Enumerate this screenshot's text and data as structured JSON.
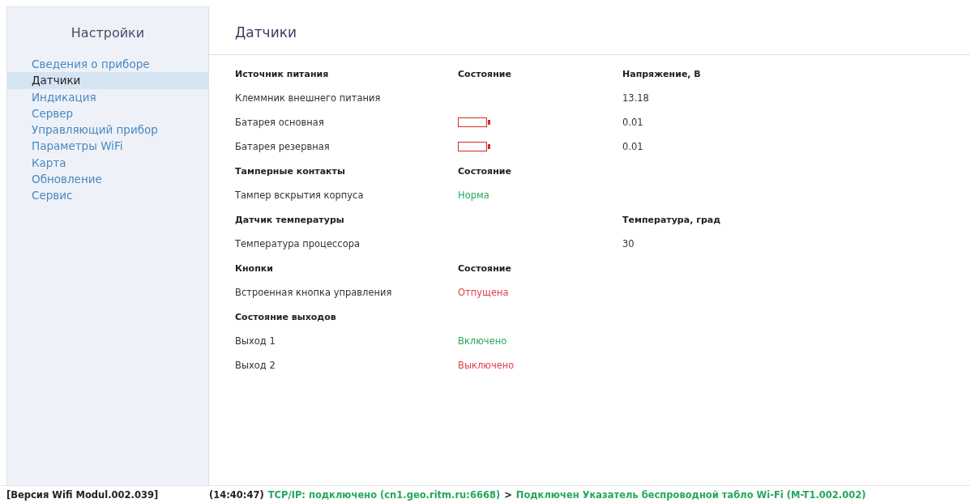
{
  "sidebar": {
    "title": "Настройки",
    "items": [
      {
        "label": "Сведения о приборе",
        "selected": false
      },
      {
        "label": "Датчики",
        "selected": true
      },
      {
        "label": "Индикация",
        "selected": false
      },
      {
        "label": "Сервер",
        "selected": false
      },
      {
        "label": "Управляющий прибор",
        "selected": false
      },
      {
        "label": "Параметры WiFi",
        "selected": false
      },
      {
        "label": "Карта",
        "selected": false
      },
      {
        "label": "Обновление",
        "selected": false
      },
      {
        "label": "Сервис",
        "selected": false
      }
    ]
  },
  "page": {
    "title": "Датчики"
  },
  "sections": [
    {
      "headers": {
        "name": "Источник питания",
        "status": "Состояние",
        "value": "Напряжение, В"
      },
      "rows": [
        {
          "name": "Клеммник внешнего питания",
          "value": "13.18"
        },
        {
          "name": "Батарея основная",
          "battery": {
            "level": 0
          },
          "value": "0.01"
        },
        {
          "name": "Батарея резервная",
          "battery": {
            "level": 0
          },
          "value": "0.01"
        }
      ]
    },
    {
      "headers": {
        "name": "Тамперные контакты",
        "status": "Состояние"
      },
      "rows": [
        {
          "name": "Тампер вскрытия корпуса",
          "status": {
            "text": "Норма",
            "color": "#25a75a"
          }
        }
      ]
    },
    {
      "headers": {
        "name": "Датчик температуры",
        "value": "Температура, град"
      },
      "rows": [
        {
          "name": "Температура процессора",
          "value": "30"
        }
      ]
    },
    {
      "headers": {
        "name": "Кнопки",
        "status": "Состояние"
      },
      "rows": [
        {
          "name": "Встроенная кнопка управления",
          "status": {
            "text": "Отпущена",
            "color": "#e0404a"
          }
        }
      ]
    },
    {
      "headers": {
        "name": "Состояние выходов"
      },
      "rows": [
        {
          "name": "Выход 1",
          "status": {
            "text": "Включено",
            "color": "#25a75a"
          }
        },
        {
          "name": "Выход 2",
          "status": {
            "text": "Выключено",
            "color": "#e0404a"
          }
        }
      ]
    }
  ],
  "status_bar": {
    "version": "[Версия Wifi Modul.002.039]",
    "segments": [
      {
        "text": "(14:40:47)",
        "color": "#222222"
      },
      {
        "text": "TCP/IP: подключено (cn1.geo.ritm.ru:6668)",
        "color": "#25a75a"
      },
      {
        "text": ">",
        "color": "#222222"
      },
      {
        "text": "Подключен Указатель беспроводной табло Wi-Fi (M-T1.002.002)",
        "color": "#25a75a"
      }
    ]
  }
}
